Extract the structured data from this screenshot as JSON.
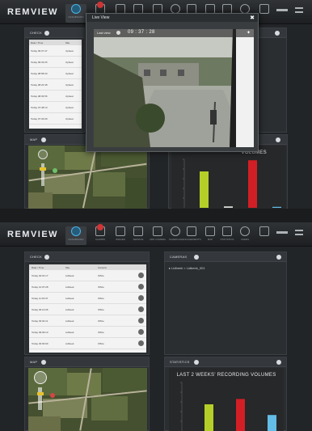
{
  "app": {
    "logo": "REMVIEW"
  },
  "nav": [
    {
      "label": "DASHBOARD",
      "icon": "dashboard-icon"
    },
    {
      "label": "ALARMS",
      "icon": "alarm-icon"
    },
    {
      "label": "IMAGES",
      "icon": "images-icon"
    },
    {
      "label": "SERVICE",
      "icon": "service-icon"
    },
    {
      "label": "ADD CAMERA",
      "icon": "camera-add-icon"
    },
    {
      "label": "SCHEDULE",
      "icon": "schedule-icon"
    },
    {
      "label": "ENGAGEMENTS",
      "icon": "engagement-icon"
    },
    {
      "label": "MAP",
      "icon": "map-icon"
    },
    {
      "label": "STATISTICS",
      "icon": "statistics-icon"
    },
    {
      "label": "USERS",
      "icon": "users-icon"
    },
    {
      "label": "",
      "icon": "messages-icon"
    }
  ],
  "screens": [
    {
      "check_title": "CHECK",
      "table_headers": [
        "Date / Time",
        "Site"
      ],
      "rows": [
        {
          "time": "Today 09:37:47",
          "site": "Upbeat"
        },
        {
          "time": "Today 09:33:25",
          "site": "Upbeat"
        },
        {
          "time": "Today 08:58:33",
          "site": "Upbeat"
        },
        {
          "time": "Today 08:22:48",
          "site": "Upbeat"
        },
        {
          "time": "Today 08:03:56",
          "site": "Upbeat"
        },
        {
          "time": "Today 07:48:13",
          "site": "Upbeat"
        },
        {
          "time": "Today 07:33:09",
          "site": "Upbeat"
        }
      ],
      "map_title": "MAP",
      "chart_title": "VOLUMES",
      "modal": {
        "title": "Live View",
        "camera": "Last view",
        "timestamp": "09 : 37 : 28",
        "close": "✖"
      }
    },
    {
      "check_title": "CHECK",
      "table_headers": [
        "Date / Time",
        "Site",
        "Camera"
      ],
      "rows": [
        {
          "time": "Today 04:01:17",
          "site": "Lidbeek",
          "camera": "Office"
        },
        {
          "time": "Today 12:07:28",
          "site": "Lidbeek",
          "camera": "Office"
        },
        {
          "time": "Today 11:33:37",
          "site": "Lidbeek",
          "camera": "Office"
        },
        {
          "time": "Today 03:12:06",
          "site": "Lidbeek",
          "camera": "Office"
        },
        {
          "time": "Today 03:02:11",
          "site": "Lidbeek",
          "camera": "Office"
        },
        {
          "time": "Today 09:09:13",
          "site": "Lidbeek",
          "camera": "Office"
        },
        {
          "time": "Today 03:00:00",
          "site": "Lidbeek",
          "camera": "Office"
        }
      ],
      "cameras_title": "CAMERAS",
      "camera_item": "Lidbeek > Lidbeek_001",
      "map_title": "MAP",
      "stats_title": "STATISTICS",
      "chart_title": "LAST 2 WEEKS' RECORDING VOLUMES"
    }
  ],
  "chart_data": [
    {
      "type": "bar",
      "title": "VOLUMES",
      "categories": [
        "",
        "",
        "",
        ""
      ],
      "values": [
        0.75,
        0.03,
        0.98,
        0.02
      ],
      "colors": [
        "#b6cf28",
        "#d8d8d8",
        "#d21f25",
        "#63bde6"
      ]
    },
    {
      "type": "bar",
      "title": "LAST 2 WEEKS' RECORDING VOLUMES",
      "categories": [
        "",
        "",
        ""
      ],
      "values": [
        0.55,
        0.66,
        0.33
      ],
      "colors": [
        "#b6cf28",
        "#d21f25",
        "#63bde6"
      ]
    }
  ],
  "colors": {
    "accent": "#4fb3e6",
    "alert": "#d23535",
    "bar_green": "#b6cf28",
    "bar_red": "#d21f25",
    "bar_blue": "#63bde6"
  }
}
